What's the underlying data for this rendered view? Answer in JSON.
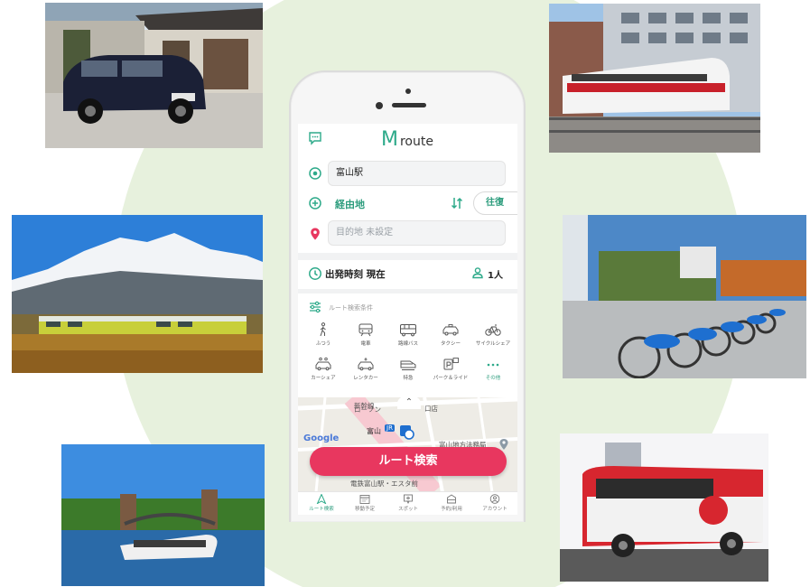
{
  "app": {
    "logo_m": "M",
    "logo_text": "route"
  },
  "route_form": {
    "origin_value": "富山駅",
    "via_label": "経由地",
    "roundtrip_label": "往復",
    "destination_placeholder": "目的地 未設定",
    "departure_label": "出発時刻 現在",
    "passengers_label": "1人"
  },
  "conditions": {
    "label": "ルート検索条件",
    "modes": [
      {
        "label": "ふつう",
        "icon": "walk-icon"
      },
      {
        "label": "電車",
        "icon": "train-icon"
      },
      {
        "label": "路線バス",
        "icon": "bus-icon"
      },
      {
        "label": "タクシー",
        "icon": "taxi-icon"
      },
      {
        "label": "サイクルシェア",
        "icon": "bicycle-icon"
      },
      {
        "label": "カーシェア",
        "icon": "carshare-icon"
      },
      {
        "label": "レンタカー",
        "icon": "rentalcar-icon"
      },
      {
        "label": "特急",
        "icon": "express-train-icon"
      },
      {
        "label": "パーク＆ライド",
        "icon": "park-and-ride-icon"
      },
      {
        "label": "その他",
        "icon": "more-icon"
      }
    ]
  },
  "map": {
    "label_lawson": "ローソン",
    "label_shop": "口店",
    "label_jr": "JR",
    "label_toyama": "富山",
    "label_office": "富山地方法務局",
    "label_station_front": "電鉄富山駅・エスタ前",
    "label_line": "新幹線",
    "google": "Google"
  },
  "search_button": "ルート検索",
  "tabbar": [
    {
      "label": "ルート検索",
      "icon": "route-search-icon",
      "active": true
    },
    {
      "label": "移動予定",
      "icon": "calendar-icon",
      "active": false
    },
    {
      "label": "スポット",
      "icon": "spot-icon",
      "active": false
    },
    {
      "label": "予約/利用",
      "icon": "ticket-icon",
      "active": false
    },
    {
      "label": "アカウント",
      "icon": "account-icon",
      "active": false
    }
  ],
  "colors": {
    "brand_green": "#2eaa8a",
    "accent_pink": "#e8375f",
    "background_circle": "#e7f1dd"
  },
  "photos": [
    {
      "name": "taxi-photo"
    },
    {
      "name": "tram-photo"
    },
    {
      "name": "train-mountain-photo"
    },
    {
      "name": "bike-share-photo"
    },
    {
      "name": "water-bus-photo"
    },
    {
      "name": "community-bus-photo"
    }
  ]
}
